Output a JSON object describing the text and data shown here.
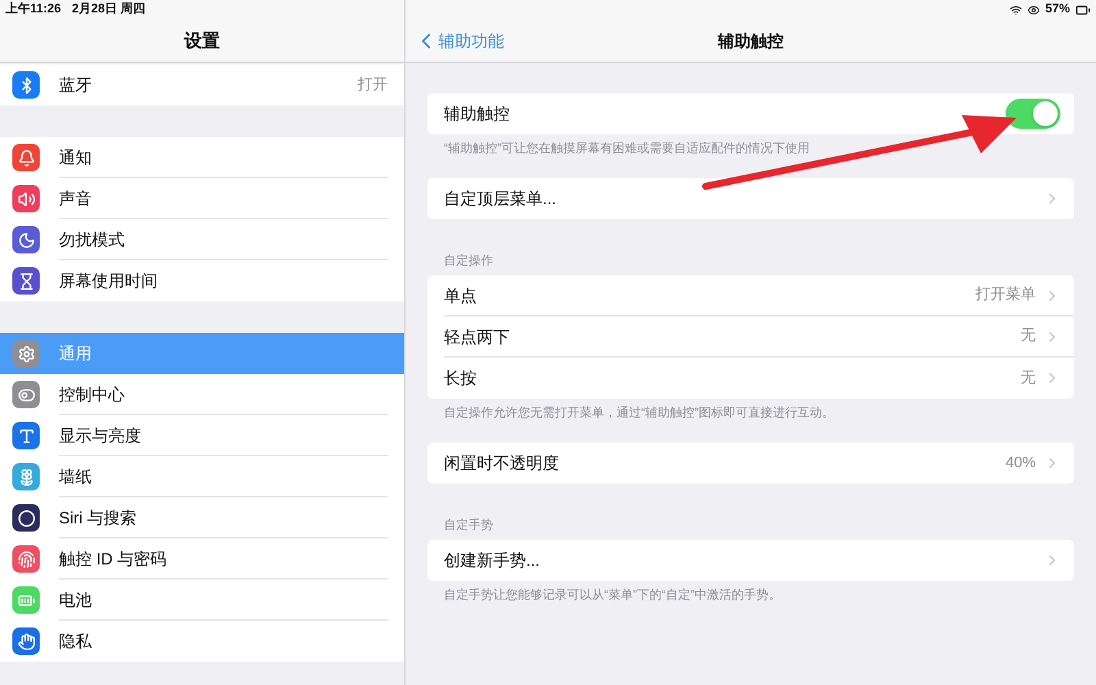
{
  "status_bar": {
    "time": "上午11:26",
    "date": "2月28日 周四",
    "battery": "57%"
  },
  "sidebar": {
    "title": "设置",
    "groups": [
      [
        {
          "label": "蓝牙",
          "value": "打开",
          "color": "#1a7cf5",
          "selected": false
        }
      ],
      [
        {
          "label": "通知",
          "color": "#f04438",
          "selected": false
        },
        {
          "label": "声音",
          "color": "#ef3e5b",
          "selected": false
        },
        {
          "label": "勿扰模式",
          "color": "#5b5bd6",
          "selected": false
        },
        {
          "label": "屏幕使用时间",
          "color": "#5a4fcf",
          "selected": false
        }
      ],
      [
        {
          "label": "通用",
          "color": "#8e8e93",
          "selected": true
        },
        {
          "label": "控制中心",
          "color": "#8e8e93",
          "selected": false
        },
        {
          "label": "显示与亮度",
          "color": "#1a73e8",
          "selected": false
        },
        {
          "label": "墙纸",
          "color": "#35aadc",
          "selected": false
        },
        {
          "label": "Siri 与搜索",
          "color": "#2b2b5e",
          "selected": false
        },
        {
          "label": "触控 ID 与密码",
          "color": "#ef4e64",
          "selected": false
        },
        {
          "label": "电池",
          "color": "#4cd964",
          "selected": false
        },
        {
          "label": "隐私",
          "color": "#1a6ee8",
          "selected": false
        }
      ]
    ]
  },
  "detail": {
    "back": "辅助功能",
    "title": "辅助触控",
    "sections": [
      {
        "rows": [
          {
            "kind": "toggle",
            "label": "辅助触控",
            "on": true
          }
        ],
        "footer": "“辅助触控”可让您在触摸屏幕有困难或需要自适应配件的情况下使用"
      },
      {
        "rows": [
          {
            "kind": "link",
            "label": "自定顶层菜单..."
          }
        ]
      },
      {
        "header": "自定操作",
        "rows": [
          {
            "kind": "link",
            "label": "单点",
            "value": "打开菜单"
          },
          {
            "kind": "link",
            "label": "轻点两下",
            "value": "无"
          },
          {
            "kind": "link",
            "label": "长按",
            "value": "无"
          }
        ],
        "footer": "自定操作允许您无需打开菜单，通过“辅助触控”图标即可直接进行互动。"
      },
      {
        "rows": [
          {
            "kind": "link",
            "label": "闲置时不透明度",
            "value": "40%"
          }
        ]
      },
      {
        "header": "自定手势",
        "rows": [
          {
            "kind": "link",
            "label": "创建新手势..."
          }
        ],
        "footer": "自定手势让您能够记录可以从“菜单”下的“自定”中激活的手势。"
      }
    ]
  }
}
